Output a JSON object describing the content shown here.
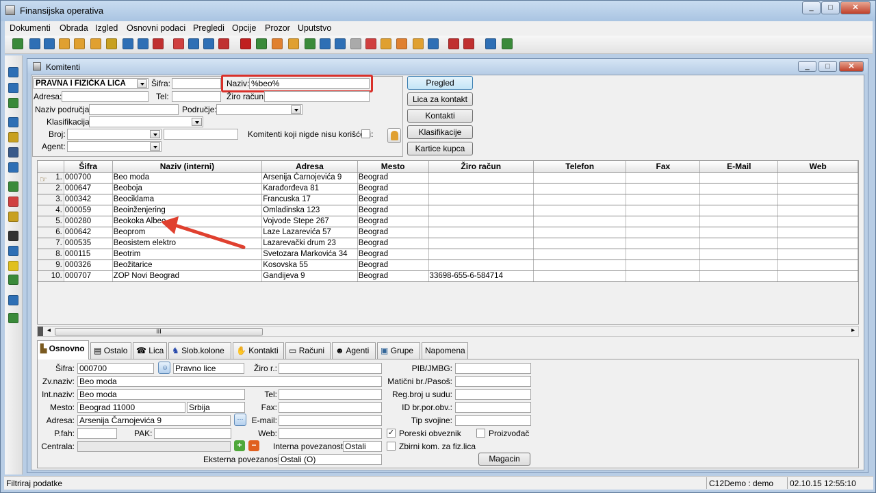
{
  "window": {
    "title": "Finansijska operativa",
    "min": "_",
    "max": "□",
    "close": "✕"
  },
  "menu": [
    "Dokumenti",
    "Obrada",
    "Izgled",
    "Osnovni podaci",
    "Pregledi",
    "Opcije",
    "Prozor",
    "Uputstvo"
  ],
  "child": {
    "title": "Komitenti"
  },
  "filter": {
    "type_value": "PRAVNA I FIZIČKA LICA",
    "sifra_label": "Šifra:",
    "sifra_value": "",
    "naziv_label": "Naziv:",
    "naziv_value": "%beo%",
    "adresa_label": "Adresa:",
    "tel_label": "Tel:",
    "ziro_label": "Žiro račun:",
    "naziv_podrucja_label": "Naziv područja:",
    "podrucje_label": "Područje:",
    "klasifikacija_label": "Klasifikacija:",
    "broj_label": "Broj:",
    "agent_label": "Agent:",
    "unused_label": "Komitenti koji nigde nisu korišćeni:"
  },
  "buttons": {
    "pregled": "Pregled",
    "lica": "Lica za kontakt",
    "kontakti": "Kontakti",
    "klasifikacije": "Klasifikacije",
    "kartice": "Kartice kupca"
  },
  "grid": {
    "columns": [
      "Šifra",
      "Naziv (interni)",
      "Adresa",
      "Mesto",
      "Žiro račun",
      "Telefon",
      "Fax",
      "E-Mail",
      "Web"
    ],
    "rows": [
      [
        "1.",
        "000700",
        "Beo moda",
        "Arsenija Čarnojevića 9",
        "Beograd",
        "",
        "",
        "",
        "",
        ""
      ],
      [
        "2.",
        "000647",
        "Beoboja",
        "Karađorđeva 81",
        "Beograd",
        "",
        "",
        "",
        "",
        ""
      ],
      [
        "3.",
        "000342",
        "Beociklama",
        "Francuska 17",
        "Beograd",
        "",
        "",
        "",
        "",
        ""
      ],
      [
        "4.",
        "000059",
        "Beoinženjering",
        "Omladinska 123",
        "Beograd",
        "",
        "",
        "",
        "",
        ""
      ],
      [
        "5.",
        "000280",
        "Beokoka Albeo",
        "Vojvode Stepe 267",
        "Beograd",
        "",
        "",
        "",
        "",
        ""
      ],
      [
        "6.",
        "000642",
        "Beoprom",
        "Laze Lazarevića 57",
        "Beograd",
        "",
        "",
        "",
        "",
        ""
      ],
      [
        "7.",
        "000535",
        "Beosistem elektro",
        "Lazarevački drum 23",
        "Beograd",
        "",
        "",
        "",
        "",
        ""
      ],
      [
        "8.",
        "000115",
        "Beotrim",
        "Svetozara Markovića 34",
        "Beograd",
        "",
        "",
        "",
        "",
        ""
      ],
      [
        "9.",
        "000326",
        "Beožitarice",
        "Kosovska 55",
        "Beograd",
        "",
        "",
        "",
        "",
        ""
      ],
      [
        "10.",
        "000707",
        "ZOP Novi Beograd",
        "Gandijeva 9",
        "Beograd",
        "33698-655-6-584714",
        "",
        "",
        "",
        ""
      ]
    ],
    "scroll_grip": "III"
  },
  "tabs": [
    "Osnovno",
    "Ostalo",
    "Lica",
    "Slob.kolone",
    "Kontakti",
    "Računi",
    "Agenti",
    "Grupe",
    "Napomena"
  ],
  "detail": {
    "sifra_label": "Šifra:",
    "sifra": "000700",
    "vrsta": "Pravno lice",
    "ziro_label": "Žiro r.:",
    "pib_label": "PIB/JMBG:",
    "zvnaziv_label": "Zv.naziv:",
    "zvnaziv": "Beo moda",
    "maticni_label": "Matični br./Pasoš:",
    "intnaziv_label": "Int.naziv:",
    "intnaziv": "Beo moda",
    "tel_label": "Tel:",
    "regbroj_label": "Reg.broj u sudu:",
    "mesto_label": "Mesto:",
    "mesto": "Beograd  11000",
    "drzava": "Srbija",
    "fax_label": "Fax:",
    "idbr_label": "ID br.por.obv.:",
    "adresa_label": "Adresa:",
    "adresa": "Arsenija Čarnojevića 9",
    "email_label": "E-mail:",
    "tip_label": "Tip svojine:",
    "pfah_label": "P.fah:",
    "pak_label": "PAK:",
    "web_label": "Web:",
    "poreski_label": "Poreski obveznik",
    "proizvodjac_label": "Proizvođač",
    "centrala_label": "Centrala:",
    "interna_label": "Interna povezanost:",
    "interna": "Ostali",
    "zbirni_label": "Zbirni kom. za fiz.lica",
    "eksterna_label": "Eksterna povezanost:",
    "eksterna": "Ostali (O)",
    "magacin": "Magacin"
  },
  "status": {
    "left": "Filtriraj podatke",
    "user": "C12Demo : demo",
    "datetime": "02.10.15 12:55:10"
  },
  "colors": {
    "highlight": "#d9302a",
    "arrow": "#e0402f"
  }
}
